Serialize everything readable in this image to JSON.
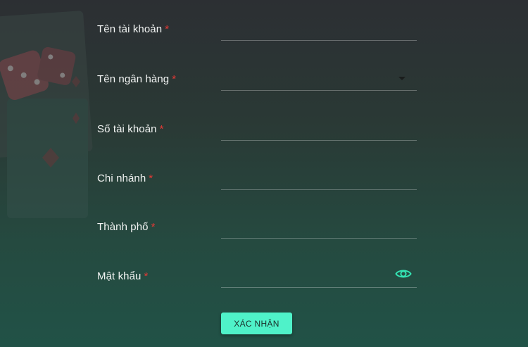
{
  "form": {
    "fields": [
      {
        "label": "Tên tài khoản",
        "required": "*",
        "value": "",
        "type": "text"
      },
      {
        "label": "Tên ngân hàng",
        "required": "*",
        "value": "",
        "type": "select"
      },
      {
        "label": "Số tài khoản",
        "required": "*",
        "value": "",
        "type": "text"
      },
      {
        "label": "Chi nhánh",
        "required": "*",
        "value": "",
        "type": "text"
      },
      {
        "label": "Thành phố",
        "required": "*",
        "value": "",
        "type": "text"
      },
      {
        "label": "Mật khẩu",
        "required": "*",
        "value": "",
        "type": "password"
      }
    ],
    "submit_label": "XÁC NHẬN"
  },
  "icons": {
    "bank_dropdown": "chevron-down-icon",
    "password_toggle": "eye-icon"
  },
  "colors": {
    "accent": "#4ff2c9",
    "required_star": "#e53935",
    "eye_icon": "#34e3b3",
    "label_text": "#f2f4f3"
  }
}
